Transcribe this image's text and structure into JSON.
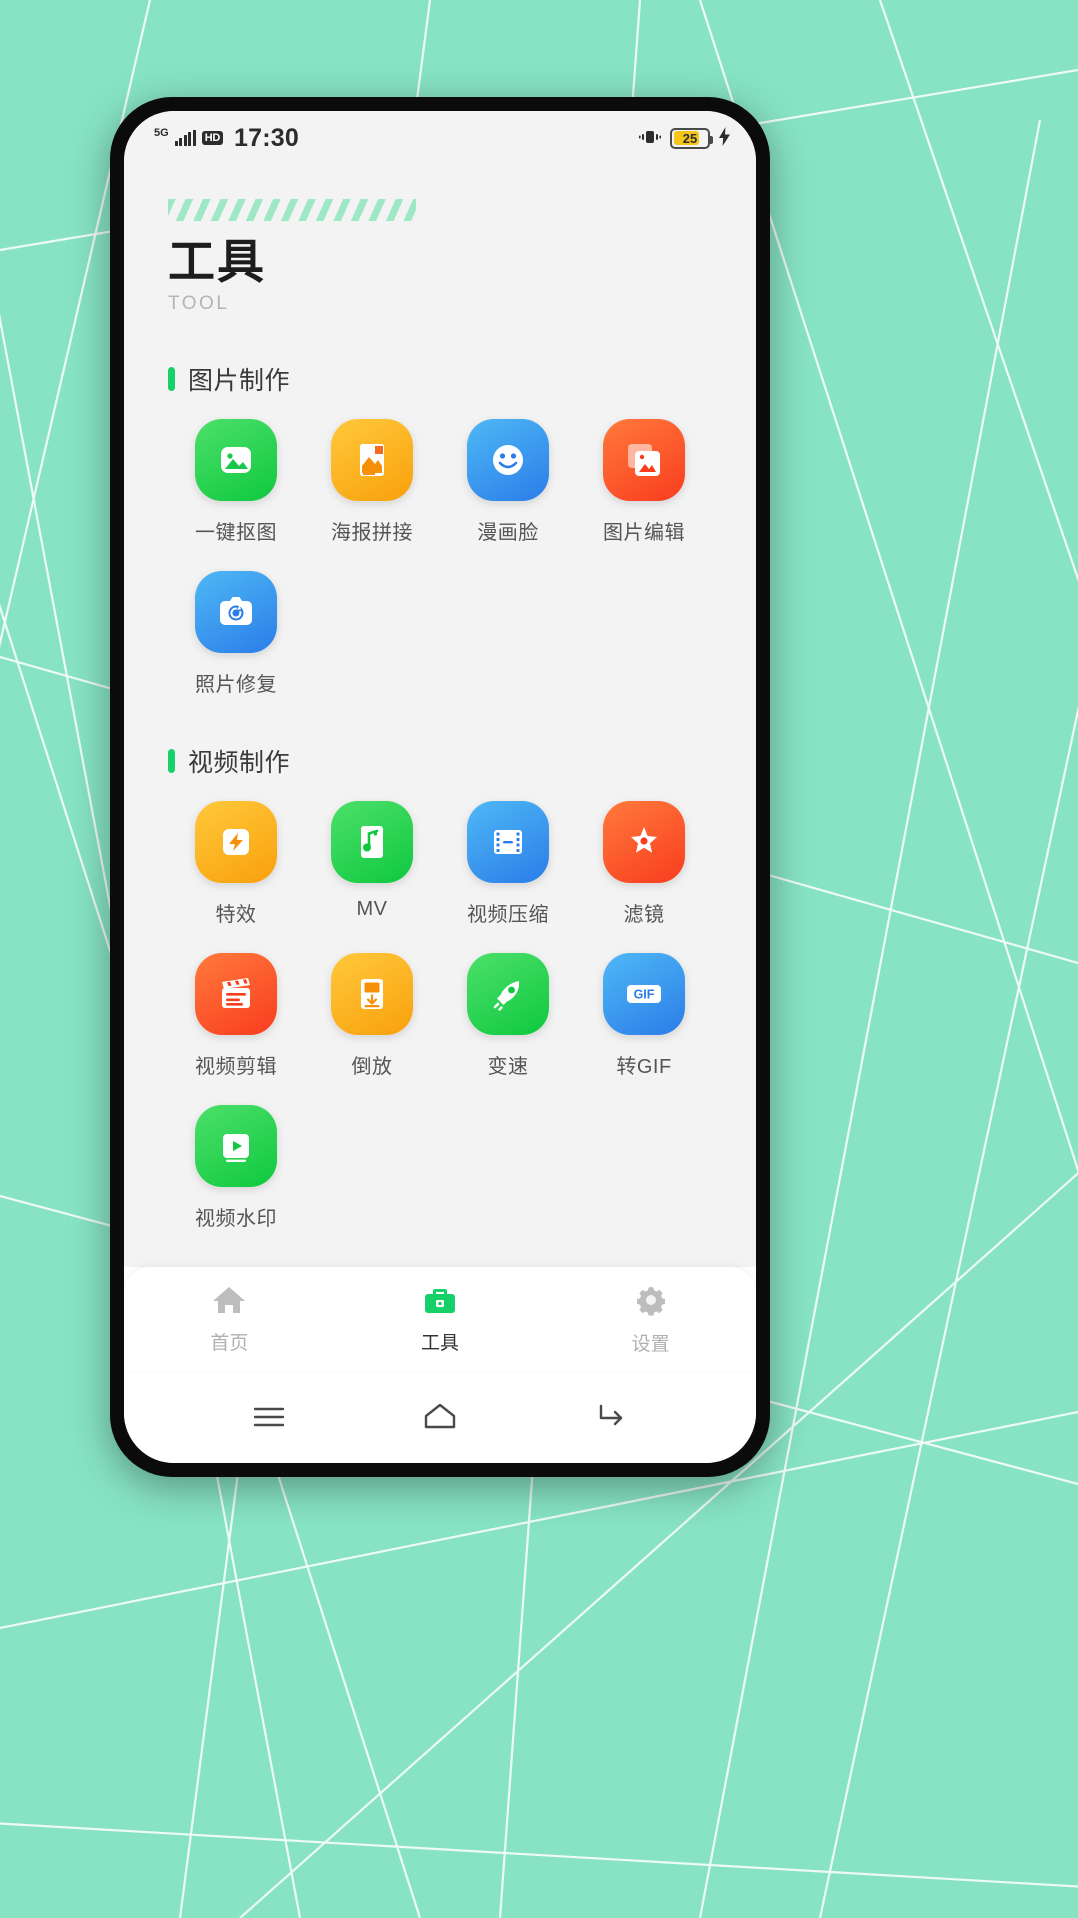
{
  "status_bar": {
    "network": "5G",
    "hd_label": "HD",
    "time": "17:30",
    "vibrate_icon": "vibrate-icon",
    "battery_level": "25",
    "battery_fill_color": "#f5c518",
    "charging_icon": "charging-bolt-icon"
  },
  "header": {
    "title": "工具",
    "subtitle": "TOOL",
    "hatch_color": "#9fe8c6"
  },
  "accent_color": "#17d067",
  "sections": [
    {
      "title": "图片制作",
      "items": [
        {
          "label": "一键抠图",
          "icon": "image-cutout-icon",
          "bg_from": "#4ce06a",
          "bg_to": "#0fc83f"
        },
        {
          "label": "海报拼接",
          "icon": "poster-collage-icon",
          "bg_from": "#ffc93c",
          "bg_to": "#f9a00b"
        },
        {
          "label": "漫画脸",
          "icon": "comic-face-icon",
          "bg_from": "#4fb8f5",
          "bg_to": "#2a7de8"
        },
        {
          "label": "图片编辑",
          "icon": "image-edit-icon",
          "bg_from": "#ff7a3c",
          "bg_to": "#f93c1e"
        },
        {
          "label": "照片修复",
          "icon": "photo-restore-icon",
          "bg_from": "#4fb8f5",
          "bg_to": "#2a7de8"
        }
      ]
    },
    {
      "title": "视频制作",
      "items": [
        {
          "label": "特效",
          "icon": "special-effects-icon",
          "bg_from": "#ffc93c",
          "bg_to": "#f9a00b"
        },
        {
          "label": "MV",
          "icon": "music-video-icon",
          "bg_from": "#4ce06a",
          "bg_to": "#0fc83f"
        },
        {
          "label": "视频压缩",
          "icon": "video-compress-icon",
          "bg_from": "#4fb8f5",
          "bg_to": "#2a7de8"
        },
        {
          "label": "滤镜",
          "icon": "filter-icon",
          "bg_from": "#ff7a3c",
          "bg_to": "#f93c1e"
        },
        {
          "label": "视频剪辑",
          "icon": "video-clip-icon",
          "bg_from": "#ff7a3c",
          "bg_to": "#f93c1e"
        },
        {
          "label": "倒放",
          "icon": "reverse-play-icon",
          "bg_from": "#ffc93c",
          "bg_to": "#f9a00b"
        },
        {
          "label": "变速",
          "icon": "speed-change-icon",
          "bg_from": "#4ce06a",
          "bg_to": "#0fc83f"
        },
        {
          "label": "转GIF",
          "icon": "convert-gif-icon",
          "bg_from": "#4fb8f5",
          "bg_to": "#2a7de8",
          "glyph_text": "GIF"
        },
        {
          "label": "视频水印",
          "icon": "video-watermark-icon",
          "bg_from": "#4ce06a",
          "bg_to": "#0fc83f"
        }
      ]
    }
  ],
  "tabbar": [
    {
      "label": "首页",
      "icon": "home-icon",
      "active": false
    },
    {
      "label": "工具",
      "icon": "toolbox-icon",
      "active": true
    },
    {
      "label": "设置",
      "icon": "gear-icon",
      "active": false
    }
  ],
  "system_nav": [
    {
      "icon": "menu-icon"
    },
    {
      "icon": "home-outline-icon"
    },
    {
      "icon": "back-icon"
    }
  ]
}
